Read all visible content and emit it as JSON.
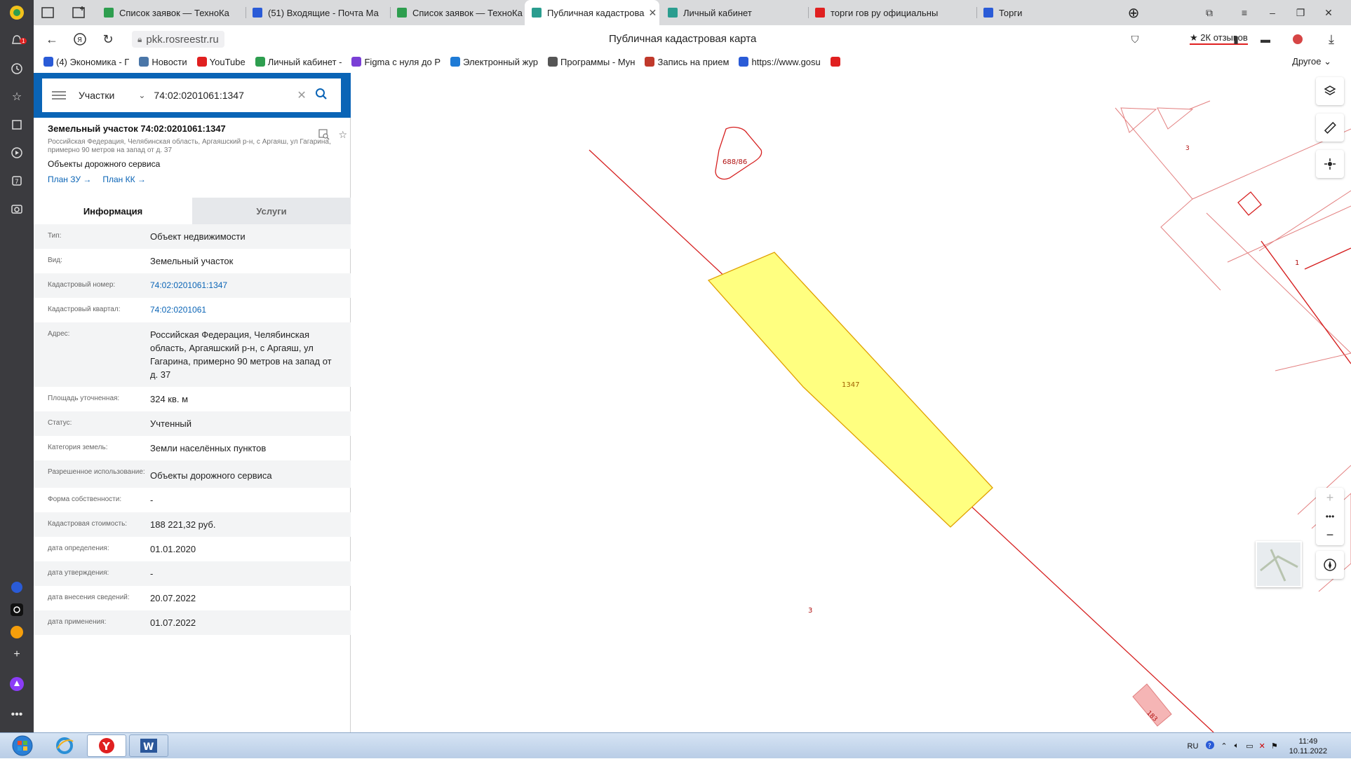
{
  "browser": {
    "tabs": [
      {
        "label": "Список заявок — ТехноКа",
        "fav": "#2e9e4f"
      },
      {
        "label": "(51) Входящие - Почта Ма",
        "fav": "#2a5bd7"
      },
      {
        "label": "Список заявок — ТехноКа",
        "fav": "#2e9e4f"
      },
      {
        "label": "Публичная кадастрова",
        "fav": "#2a9d8f"
      },
      {
        "label": "Личный кабинет",
        "fav": "#2a9d8f"
      },
      {
        "label": "торги гов ру официальны",
        "fav": "#e02020"
      },
      {
        "label": "Торги",
        "fav": "#2a5bd7"
      }
    ],
    "address": "pkk.rosreestr.ru",
    "page_title": "Публичная кадастровая карта",
    "reviews": "2К отзывов",
    "bookmarks": [
      {
        "label": "(4) Экономика - Г",
        "fav": "#2a5bd7"
      },
      {
        "label": "Новости",
        "fav": "#4a76a8"
      },
      {
        "label": "YouTube",
        "fav": "#e02020"
      },
      {
        "label": "Личный кабинет -",
        "fav": "#2e9e4f"
      },
      {
        "label": "Figma с нуля до Р",
        "fav": "#7a3fd6"
      },
      {
        "label": "Электронный жур",
        "fav": "#1e7bd6"
      },
      {
        "label": "Программы - Мун",
        "fav": "#555555"
      },
      {
        "label": "Запись на прием",
        "fav": "#c0392b"
      },
      {
        "label": "https://www.gosu",
        "fav": "#2a5bd7"
      }
    ],
    "bookmarks_other": "Другое"
  },
  "panel": {
    "search_type": "Участки",
    "search_value": "74:02:0201061:1347",
    "object_title": "Земельный участок 74:02:0201061:1347",
    "object_address": "Российская Федерация, Челябинская область, Аргаяшский р-н, с Аргаяш, ул Гагарина, примерно 90 метров на запад от д. 37",
    "object_use": "Объекты дорожного сервиса",
    "link_zu": "План ЗУ →",
    "link_kk": "План КК →",
    "tab_info": "Информация",
    "tab_services": "Услуги",
    "rows": [
      {
        "k": "Тип:",
        "v": "Объект недвижимости"
      },
      {
        "k": "Вид:",
        "v": "Земельный участок"
      },
      {
        "k": "Кадастровый номер:",
        "v": "74:02:0201061:1347"
      },
      {
        "k": "Кадастровый квартал:",
        "v": "74:02:0201061"
      },
      {
        "k": "Адрес:",
        "v": "Российская Федерация, Челябинская область, Аргаяшский р-н, с Аргаяш, ул Гагарина, примерно 90 метров на запад от д. 37"
      },
      {
        "k": "Площадь уточненная:",
        "v": "324 кв. м"
      },
      {
        "k": "Статус:",
        "v": "Учтенный"
      },
      {
        "k": "Категория земель:",
        "v": "Земли населённых пунктов"
      },
      {
        "k": "Разрешенное использование:",
        "v": "Объекты дорожного сервиса"
      },
      {
        "k": "Форма собственности:",
        "v": "-"
      },
      {
        "k": "Кадастровая стоимость:",
        "v": "188 221,32 руб."
      },
      {
        "k": "дата определения:",
        "v": "01.01.2020"
      },
      {
        "k": "дата утверждения:",
        "v": "-"
      },
      {
        "k": "дата внесения сведений:",
        "v": "20.07.2022"
      },
      {
        "k": "дата применения:",
        "v": "01.07.2022"
      }
    ]
  },
  "map": {
    "labels": {
      "parcel_main": "1347",
      "parcel_top": "688/86",
      "label_3a": "3",
      "label_3b": "3",
      "label_1": "1",
      "label_183": "183"
    },
    "colors": {
      "parcel_fill": "#ffff80",
      "boundary": "#d62020",
      "selected_edge": "#e0a000"
    }
  },
  "taskbar": {
    "lang": "RU",
    "time": "11:49",
    "date": "10.11.2022"
  }
}
